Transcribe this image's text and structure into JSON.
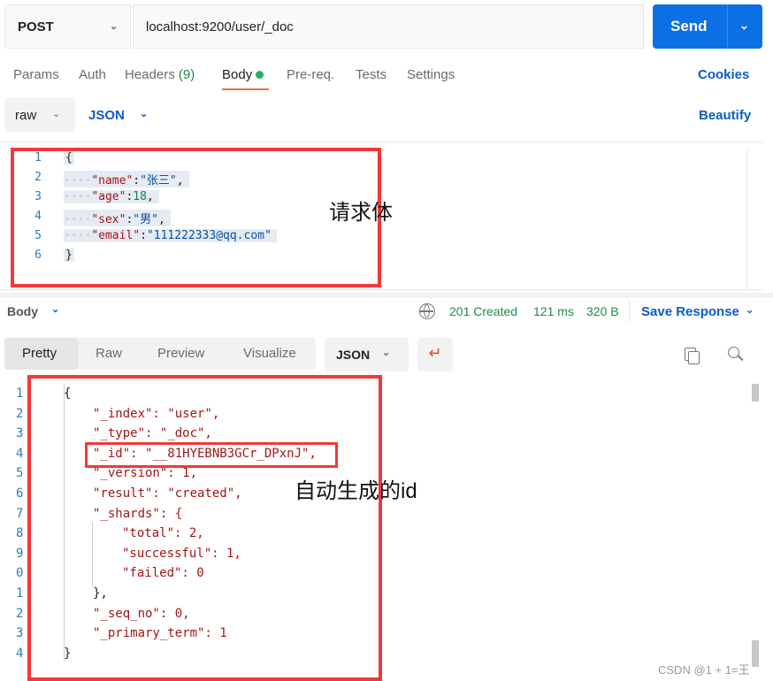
{
  "request": {
    "method": "POST",
    "url": "localhost:9200/user/_doc",
    "send_label": "Send"
  },
  "tabs": [
    {
      "label": "Params"
    },
    {
      "label": "Auth"
    },
    {
      "label": "Headers",
      "count": "(9)"
    },
    {
      "label": "Body",
      "active": true
    },
    {
      "label": "Pre-req."
    },
    {
      "label": "Tests"
    },
    {
      "label": "Settings"
    }
  ],
  "cookies_label": "Cookies",
  "body_options": {
    "mode": "raw",
    "language": "JSON",
    "beautify_label": "Beautify"
  },
  "request_body": {
    "line_numbers": [
      "1",
      "2",
      "3",
      "4",
      "5",
      "6"
    ],
    "lines": [
      [
        "{"
      ],
      [
        "\"name\"",
        ":",
        "\"张三\"",
        ","
      ],
      [
        "\"age\"",
        ":",
        "18",
        ","
      ],
      [
        "\"sex\"",
        ":",
        "\"男\"",
        ","
      ],
      [
        "\"email\"",
        ":",
        "\"111222333@qq.com\""
      ],
      [
        "}"
      ]
    ]
  },
  "annotations": {
    "request_body": "请求体",
    "auto_id": "自动生成的id"
  },
  "response": {
    "section_label": "Body",
    "status": "201 Created",
    "time": "121 ms",
    "size": "320 B",
    "save_label": "Save Response",
    "view_tabs": [
      "Pretty",
      "Raw",
      "Preview",
      "Visualize"
    ],
    "active_view": "Pretty",
    "format": "JSON",
    "line_numbers": [
      "1",
      "2",
      "3",
      "4",
      "5",
      "6",
      "7",
      "8",
      "9",
      "0",
      "1",
      "2",
      "3",
      "4"
    ],
    "lines": [
      "{",
      "\"_index\": \"user\",",
      "\"_type\": \"_doc\",",
      "\"_id\": \"__81HYEBNB3GCr_DPxnJ\",",
      "\"_version\": 1,",
      "\"result\": \"created\",",
      "\"_shards\": {",
      "\"total\": 2,",
      "\"successful\": 1,",
      "\"failed\": 0",
      "},",
      "\"_seq_no\": 0,",
      "\"_primary_term\": 1",
      "}"
    ]
  },
  "watermark": "CSDN @1 + 1=王",
  "colors": {
    "accent": "#0c6fe6",
    "annotation": "#f33838",
    "status": "#1e8a4c"
  }
}
